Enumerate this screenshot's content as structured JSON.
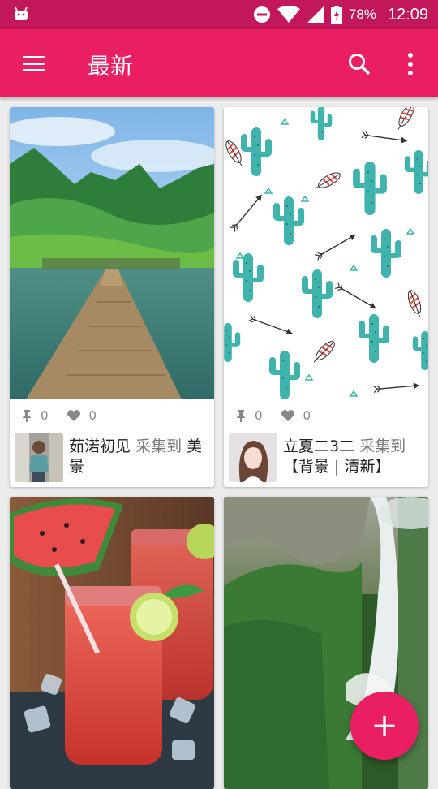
{
  "status_bar": {
    "battery_percent": "78%",
    "time": "12:09"
  },
  "app_bar": {
    "title": "最新"
  },
  "cards": [
    {
      "pins": "0",
      "likes": "0",
      "user": "茹渃初见",
      "verb": "采集到",
      "board": "美景"
    },
    {
      "pins": "0",
      "likes": "0",
      "user": "立夏二3二",
      "verb": "采集到",
      "board": "【背景 | 清新】"
    }
  ],
  "fab": {
    "label": "+"
  },
  "colors": {
    "primary": "#e91e63",
    "primary_dark": "#c2185b"
  },
  "icons": [
    "android-icon",
    "dnd-icon",
    "wifi-icon",
    "signal-icon",
    "battery-icon",
    "menu-icon",
    "search-icon",
    "more-vert-icon",
    "pin-icon",
    "heart-icon",
    "add-icon"
  ]
}
